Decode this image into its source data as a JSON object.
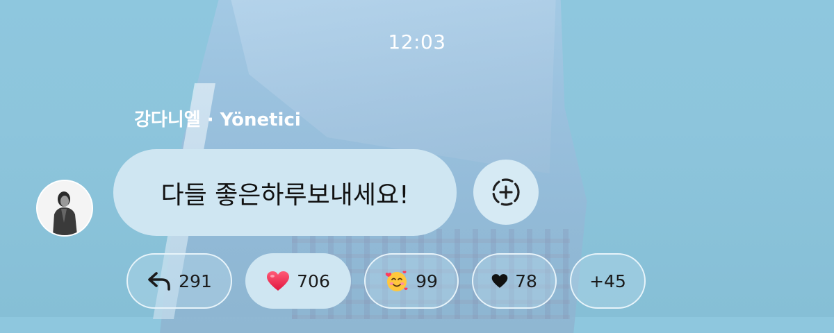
{
  "status": {
    "time": "12:03"
  },
  "message": {
    "sender_line": "강다니엘 · Yönetici",
    "text": "다들 좋은하루보내세요!"
  },
  "icons": {
    "avatar": "avatar",
    "add_reaction": "add-reaction-icon",
    "reply": "reply-arrow-icon",
    "heart_emoji": "red-heart-emoji",
    "smiling_hearts_emoji": "smiling-face-with-hearts-emoji",
    "black_heart": "black-heart-icon"
  },
  "reactions": [
    {
      "icon": "reply-arrow-icon",
      "count": "291",
      "active": false
    },
    {
      "icon": "red-heart-emoji",
      "count": "706",
      "active": true
    },
    {
      "icon": "smiling-face-with-hearts-emoji",
      "count": "99",
      "active": false
    },
    {
      "icon": "black-heart-icon",
      "count": "78",
      "active": false
    },
    {
      "icon": "",
      "count": "+45",
      "active": false
    }
  ],
  "colors": {
    "bubble": "#cfe6f2",
    "background": "#8ec7de",
    "text": "#111111",
    "heart": "#ff2d55"
  }
}
